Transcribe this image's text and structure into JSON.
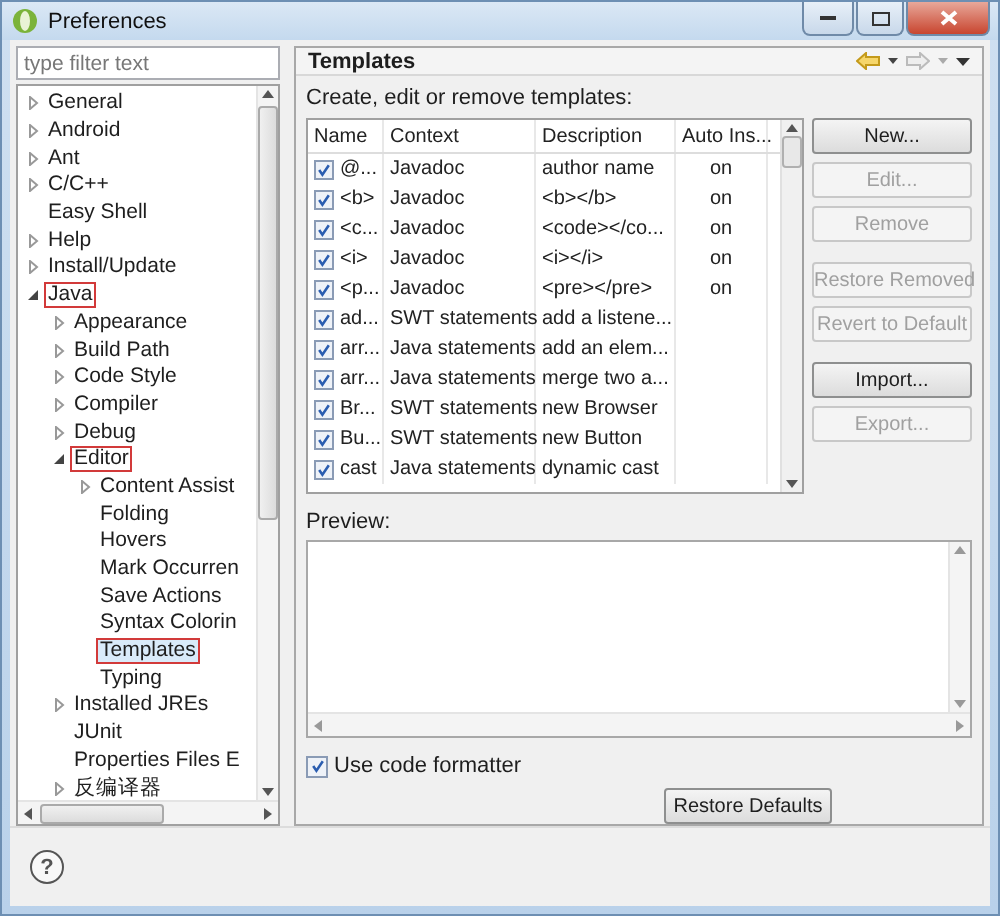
{
  "window": {
    "title": "Preferences"
  },
  "filter": {
    "placeholder": "type filter text"
  },
  "tree": [
    {
      "label": "General",
      "expanded": false,
      "selected": false,
      "marked": false
    },
    {
      "label": "Android",
      "expanded": false,
      "selected": false,
      "marked": false
    },
    {
      "label": "Ant",
      "expanded": false,
      "selected": false,
      "marked": false
    },
    {
      "label": "C/C++",
      "expanded": false,
      "selected": false,
      "marked": false
    },
    {
      "label": "Easy Shell",
      "selected": false,
      "marked": false
    },
    {
      "label": "Help",
      "expanded": false,
      "selected": false,
      "marked": false
    },
    {
      "label": "Install/Update",
      "expanded": false,
      "selected": false,
      "marked": false
    },
    {
      "label": "Java",
      "expanded": true,
      "selected": false,
      "marked": true,
      "children": [
        {
          "label": "Appearance",
          "expanded": false,
          "selected": false,
          "marked": false
        },
        {
          "label": "Build Path",
          "expanded": false,
          "selected": false,
          "marked": false
        },
        {
          "label": "Code Style",
          "expanded": false,
          "selected": false,
          "marked": false
        },
        {
          "label": "Compiler",
          "expanded": false,
          "selected": false,
          "marked": false
        },
        {
          "label": "Debug",
          "expanded": false,
          "selected": false,
          "marked": false
        },
        {
          "label": "Editor",
          "expanded": true,
          "selected": false,
          "marked": true,
          "children": [
            {
              "label": "Content Assist",
              "expanded": false,
              "selected": false,
              "marked": false
            },
            {
              "label": "Folding",
              "selected": false,
              "marked": false
            },
            {
              "label": "Hovers",
              "selected": false,
              "marked": false
            },
            {
              "label": "Mark Occurren",
              "selected": false,
              "marked": false
            },
            {
              "label": "Save Actions",
              "selected": false,
              "marked": false
            },
            {
              "label": "Syntax Colorin",
              "selected": false,
              "marked": false
            },
            {
              "label": "Templates",
              "selected": true,
              "marked": true
            },
            {
              "label": "Typing",
              "selected": false,
              "marked": false
            }
          ]
        },
        {
          "label": "Installed JREs",
          "expanded": false,
          "selected": false,
          "marked": false
        },
        {
          "label": "JUnit",
          "selected": false,
          "marked": false
        },
        {
          "label": "Properties Files E",
          "selected": false,
          "marked": false
        },
        {
          "label": "反编译器",
          "expanded": false,
          "selected": false,
          "marked": false
        }
      ]
    }
  ],
  "page": {
    "title": "Templates",
    "description": "Create, edit or remove templates:"
  },
  "table": {
    "columns": [
      "Name",
      "Context",
      "Description",
      "Auto Ins..."
    ],
    "rows": [
      {
        "checked": true,
        "name": "@...",
        "context": "Javadoc",
        "description": "author name",
        "auto_insert": "on"
      },
      {
        "checked": true,
        "name": "<b>",
        "context": "Javadoc",
        "description": "<b></b>",
        "auto_insert": "on"
      },
      {
        "checked": true,
        "name": "<c...",
        "context": "Javadoc",
        "description": "<code></co...",
        "auto_insert": "on"
      },
      {
        "checked": true,
        "name": "<i>",
        "context": "Javadoc",
        "description": "<i></i>",
        "auto_insert": "on"
      },
      {
        "checked": true,
        "name": "<p...",
        "context": "Javadoc",
        "description": "<pre></pre>",
        "auto_insert": "on"
      },
      {
        "checked": true,
        "name": "ad...",
        "context": "SWT statements",
        "description": "add a listene..."
      },
      {
        "checked": true,
        "name": "arr...",
        "context": "Java statements",
        "description": "add an elem..."
      },
      {
        "checked": true,
        "name": "arr...",
        "context": "Java statements",
        "description": "merge two a..."
      },
      {
        "checked": true,
        "name": "Br...",
        "context": "SWT statements",
        "description": "new Browser"
      },
      {
        "checked": true,
        "name": "Bu...",
        "context": "SWT statements",
        "description": "new Button"
      },
      {
        "checked": true,
        "name": "cast",
        "context": "Java statements",
        "description": "dynamic cast"
      }
    ]
  },
  "side_buttons": [
    {
      "label": "New...",
      "disabled": false
    },
    {
      "label": "Edit...",
      "disabled": true
    },
    {
      "label": "Remove",
      "disabled": true
    },
    {
      "label": "Restore Removed",
      "disabled": true
    },
    {
      "label": "Revert to Default",
      "disabled": true
    },
    {
      "label": "Import...",
      "disabled": false
    },
    {
      "label": "Export...",
      "disabled": true
    }
  ],
  "preview": {
    "label": "Preview:"
  },
  "formatter": {
    "label": "Use code formatter",
    "checked": true
  },
  "restore_button": {
    "label": "Restore Defaults"
  },
  "help_button": {
    "label": "?"
  }
}
